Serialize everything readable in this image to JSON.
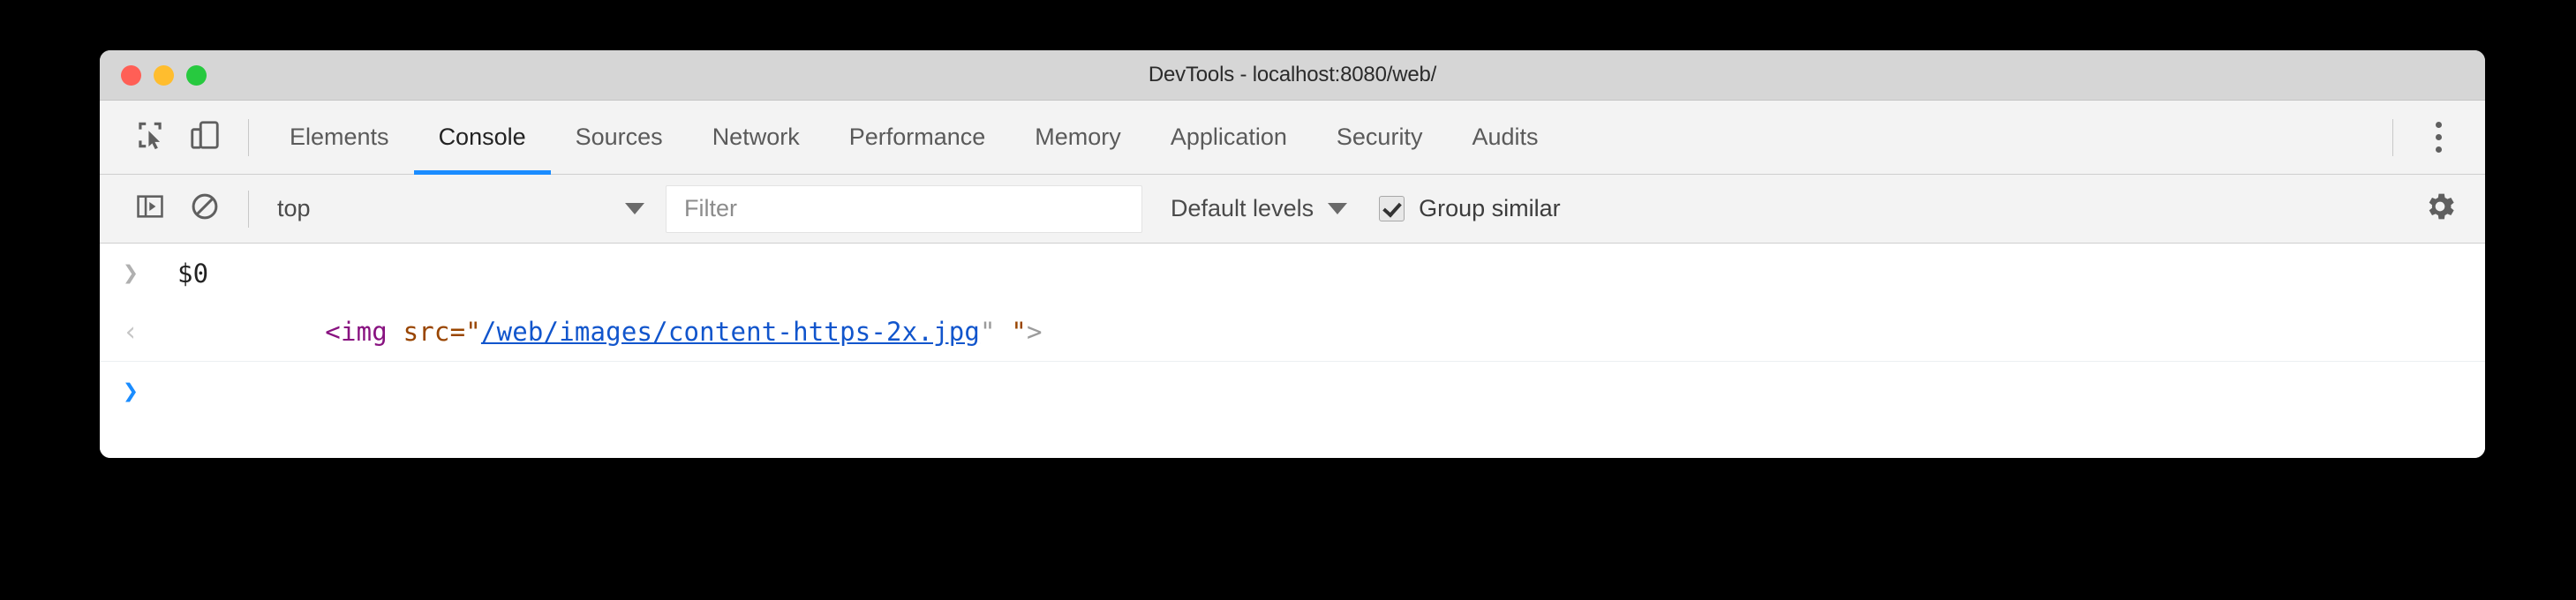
{
  "window": {
    "title": "DevTools - localhost:8080/web/",
    "traffic_lights": [
      {
        "name": "close",
        "color": "#ff5f56"
      },
      {
        "name": "minimize",
        "color": "#ffbd2e"
      },
      {
        "name": "zoom",
        "color": "#27c93f"
      }
    ]
  },
  "toolbar": {
    "inspect_icon": "inspect-element-icon",
    "device_icon": "device-toolbar-icon",
    "kebab_icon": "more-options-icon",
    "tabs": [
      {
        "label": "Elements",
        "selected": false
      },
      {
        "label": "Console",
        "selected": true
      },
      {
        "label": "Sources",
        "selected": false
      },
      {
        "label": "Network",
        "selected": false
      },
      {
        "label": "Performance",
        "selected": false
      },
      {
        "label": "Memory",
        "selected": false
      },
      {
        "label": "Application",
        "selected": false
      },
      {
        "label": "Security",
        "selected": false
      },
      {
        "label": "Audits",
        "selected": false
      }
    ],
    "accent_color": "#1a8cff"
  },
  "console_toolbar": {
    "sidebar_toggle_icon": "console-sidebar-icon",
    "clear_icon": "clear-console-icon",
    "context": "top",
    "context_caret": "chevron-down-icon",
    "filter_placeholder": "Filter",
    "filter_value": "",
    "levels_label": "Default levels",
    "levels_caret": "chevron-down-icon",
    "group_similar_label": "Group similar",
    "group_similar_checked": true,
    "settings_icon": "gear-icon"
  },
  "console": {
    "input_row": {
      "gutter": "❯",
      "text": "$0"
    },
    "result_row": {
      "gutter": "‹",
      "tokens": [
        {
          "text": "<img ",
          "type": "tag"
        },
        {
          "text": "src=",
          "type": "attr"
        },
        {
          "text": "\"",
          "type": "punct"
        },
        {
          "text": "/web/images/content-https-2x.jpg",
          "type": "link"
        },
        {
          "text": "\"",
          "type": "gray"
        },
        {
          "text": " \"",
          "type": "punct"
        },
        {
          "text": ">",
          "type": "gray"
        }
      ]
    },
    "prompt_row": {
      "gutter": "❯",
      "text": ""
    },
    "colors": {
      "tag": "#881280",
      "attribute": "#994500",
      "link": "#1155cc",
      "prompt": "#1a8cff"
    }
  }
}
